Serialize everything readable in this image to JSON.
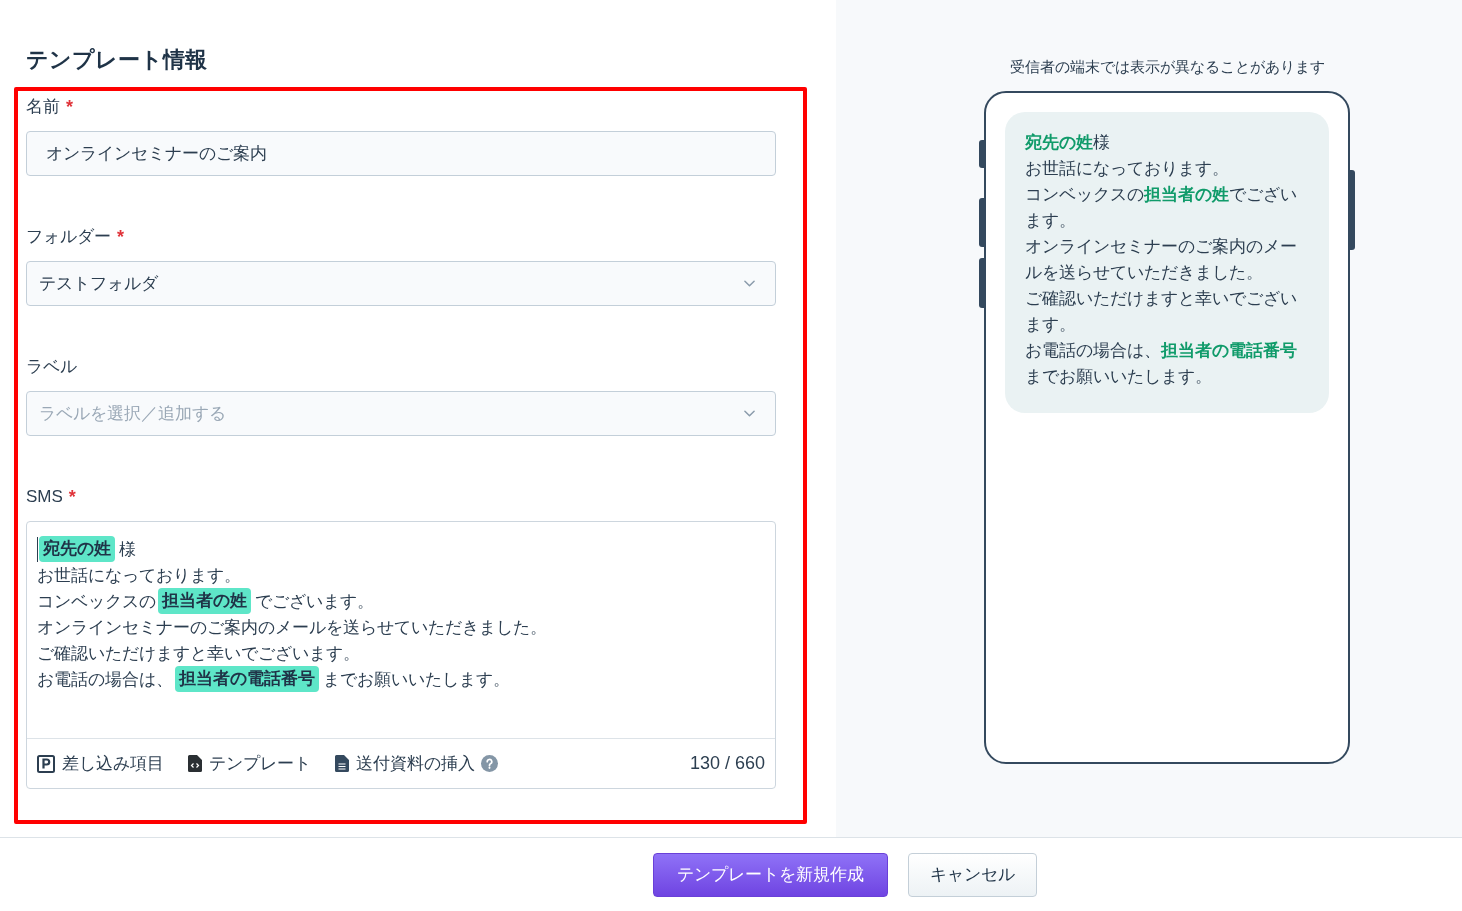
{
  "form": {
    "title": "テンプレート情報",
    "highlighted": true,
    "fields": [
      {
        "kind": "text",
        "label": "名前",
        "required_mark": "*",
        "value": "オンラインセミナーのご案内"
      },
      {
        "kind": "select",
        "label": "フォルダー",
        "required_mark": "*",
        "value": "テストフォルダ"
      },
      {
        "kind": "select",
        "label": "ラベル",
        "placeholder": "ラベルを選択／追加する"
      },
      {
        "kind": "sms",
        "label": "SMS",
        "required_mark": "*",
        "caret": true,
        "lines": [
          {
            "segments": [
              {
                "kind": "tag",
                "text": "宛先の姓"
              },
              {
                "kind": "text",
                "text": "様"
              }
            ]
          },
          {
            "segments": [
              {
                "kind": "text",
                "text": "お世話になっております。"
              }
            ]
          },
          {
            "segments": [
              {
                "kind": "text",
                "text": "コンベックスの"
              },
              {
                "kind": "tag",
                "text": "担当者の姓"
              },
              {
                "kind": "text",
                "text": "でございます。"
              }
            ]
          },
          {
            "segments": [
              {
                "kind": "text",
                "text": "オンラインセミナーのご案内のメールを送らせていただきました。"
              }
            ]
          },
          {
            "segments": [
              {
                "kind": "text",
                "text": "ご確認いただけますと幸いでございます。"
              }
            ]
          },
          {
            "segments": [
              {
                "kind": "text",
                "text": "お電話の場合は、"
              },
              {
                "kind": "tag",
                "text": "担当者の電話番号"
              },
              {
                "kind": "text",
                "text": "までお願いいたします。"
              }
            ]
          }
        ],
        "toolbar": [
          {
            "kind": "merge",
            "label": "差し込み項目"
          },
          {
            "kind": "template",
            "label": "テンプレート"
          },
          {
            "kind": "attachment",
            "label": "送付資料の挿入",
            "help": true
          }
        ],
        "counter": "130 / 660"
      }
    ]
  },
  "preview": {
    "notice": "受信者の端末では表示が異なることがあります",
    "lines": [
      {
        "segments": [
          {
            "kind": "tag",
            "text": "宛先の姓"
          },
          {
            "kind": "text",
            "text": "様"
          }
        ]
      },
      {
        "segments": [
          {
            "kind": "text",
            "text": "お世話になっております。"
          }
        ]
      },
      {
        "segments": [
          {
            "kind": "text",
            "text": "コンベックスの"
          },
          {
            "kind": "tag",
            "text": "担当者の姓"
          },
          {
            "kind": "text",
            "text": "でございます。"
          }
        ]
      },
      {
        "segments": [
          {
            "kind": "text",
            "text": "オンラインセミナーのご案内のメールを送らせていただきました。"
          }
        ]
      },
      {
        "segments": [
          {
            "kind": "text",
            "text": "ご確認いただけますと幸いでございます。"
          }
        ]
      },
      {
        "segments": [
          {
            "kind": "text",
            "text": "お電話の場合は、"
          },
          {
            "kind": "tag",
            "text": "担当者の電話番号"
          },
          {
            "kind": "text",
            "text": "までお願いいたします。"
          }
        ]
      }
    ]
  },
  "footer": {
    "buttons": [
      {
        "kind": "primary",
        "label": "テンプレートを新規作成"
      },
      {
        "kind": "secondary",
        "label": "キャンセル"
      }
    ]
  }
}
